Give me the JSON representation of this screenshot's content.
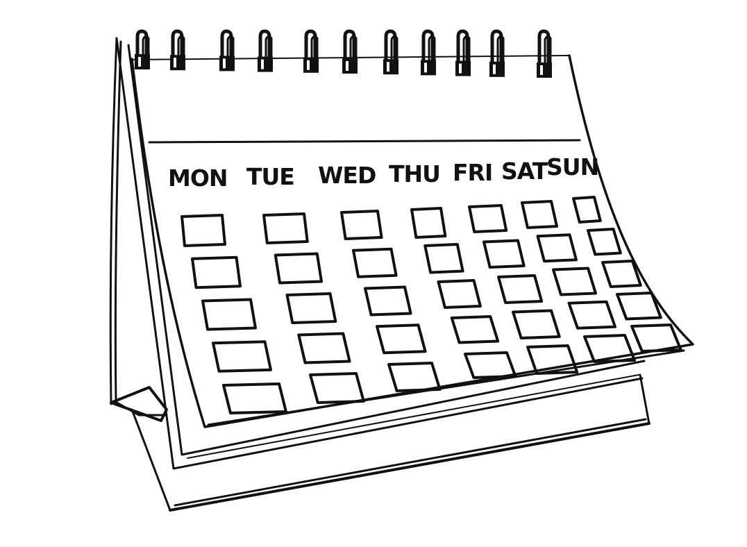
{
  "calendar": {
    "weekdays": [
      "MON",
      "TUE",
      "WED",
      "THU",
      "FRI",
      "SAT",
      "SUN"
    ],
    "ring_count": 11,
    "grid": {
      "columns": 7,
      "rows": 5,
      "empty_day_cells": 35
    },
    "ink_color": "#111111",
    "background_color": "#ffffff"
  }
}
